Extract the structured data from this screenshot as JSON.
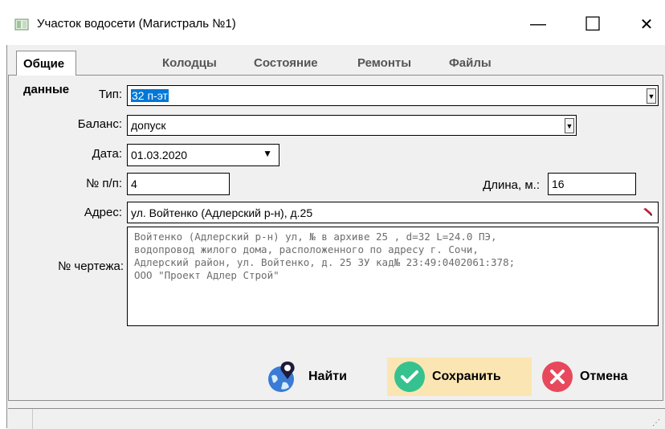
{
  "window": {
    "title": "Участок водосети (Магистраль №1)",
    "minimize_glyph": "—",
    "maximize_glyph": "☐",
    "close_glyph": "✕"
  },
  "tabs": [
    {
      "label": "Общие данные",
      "active": true
    },
    {
      "label": "Колодцы",
      "active": false
    },
    {
      "label": "Состояние",
      "active": false
    },
    {
      "label": "Ремонты",
      "active": false
    },
    {
      "label": "Файлы",
      "active": false
    }
  ],
  "form": {
    "type_label": "Тип:",
    "type_value": "32 п-эт",
    "balance_label": "Баланс:",
    "balance_value": "допуск",
    "date_label": "Дата:",
    "date_value": "01.03.2020",
    "num_label": "№ п/п:",
    "num_value": "4",
    "length_label": "Длина, м.:",
    "length_value": "16",
    "address_label": "Адрес:",
    "address_value": "ул. Войтенко (Адлерский р-н), д.25",
    "drawing_label": "№ чертежа:",
    "drawing_lines": [
      "Войтенко (Адлерский р-н) ул, № в архиве 25 , d=32 L=24.0 ПЭ,",
      "водопровод жилого дома, расположенного по адресу г. Сочи,",
      "Адлерский район, ул. Войтенко, д. 25 ЗУ кад№ 23:49:0402061:378;",
      "ООО \"Проект Адлер Строй\""
    ]
  },
  "buttons": {
    "find_label": "Найти",
    "save_label": "Сохранить",
    "cancel_label": "Отмена"
  },
  "colors": {
    "selection": "#0078d7",
    "save_highlight": "#fbe6b3",
    "save_icon": "#35c28f",
    "cancel_icon": "#e8485c",
    "find_icon": "#3a7bd5"
  },
  "icons": [
    "window-icon",
    "dropdown-arrow-icon",
    "eraser-icon",
    "map-pin-globe-icon",
    "check-icon",
    "close-x-icon"
  ]
}
